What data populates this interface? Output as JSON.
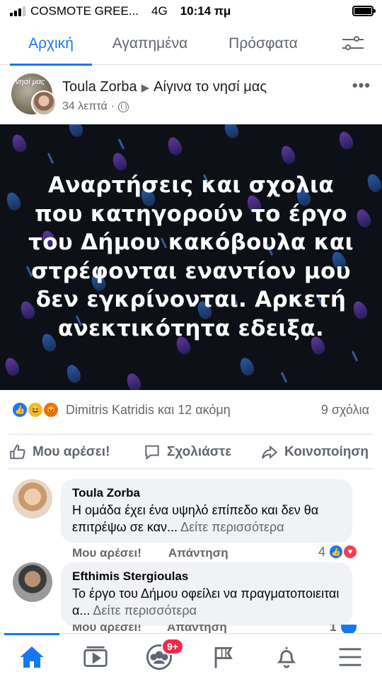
{
  "status_bar": {
    "carrier": "COSMOTE GREE...",
    "network": "4G",
    "time": "10:14 πμ"
  },
  "top_tabs": [
    {
      "label": "Αρχική",
      "active": true
    },
    {
      "label": "Αγαπημένα",
      "active": false
    },
    {
      "label": "Πρόσφατα",
      "active": false
    }
  ],
  "post": {
    "author": "Toula Zorba",
    "group": "Αίγινα το νησί μας",
    "group_thumb_text": "νησί μας",
    "time": "34 λεπτά",
    "image_text": [
      "Αναρτήσεις και σχολια",
      "που κατηγορούν το έργο",
      "του Δήμου κακόβουλα  και",
      "στρέφονται εναντίον μου",
      "δεν εγκρίνονται. Αρκετή",
      "ανεκτικότητα εδειξα."
    ],
    "reactions_text": "Dimitris Katridis και 12 ακόμη",
    "comments_count": "9 σχόλια"
  },
  "actions": {
    "like": "Μου αρέσει!",
    "comment": "Σχολιάστε",
    "share": "Κοινοποίηση"
  },
  "comments": [
    {
      "name": "Toula Zorba",
      "text": "Η ομάδα έχει ένα υψηλό  επίπεδο και δεν θα επιτρέψω σε καν... ",
      "see_more": "Δείτε περισσότερα",
      "like_label": "Μου αρέσει!",
      "reply_label": "Απάντηση",
      "reaction_count": "4"
    },
    {
      "name": "Efthimis Stergioulas",
      "text": "Το έργο του Δήμου οφείλει να πραγματοποιειται α... ",
      "see_more": "Δείτε περισσότερα",
      "like_label": "Μου αρέσει!",
      "reply_label": "Απάντηση",
      "reaction_count": "1"
    }
  ],
  "bottom_nav": {
    "groups_badge": "9+"
  },
  "colors": {
    "accent": "#1877f2",
    "badge": "#f02849",
    "image_bg": "#0e1017"
  }
}
